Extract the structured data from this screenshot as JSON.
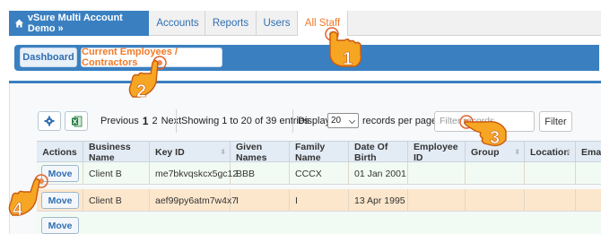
{
  "topnav": {
    "brand": "vSure Multi Account Demo »",
    "tabs": [
      {
        "label": "Accounts"
      },
      {
        "label": "Reports"
      },
      {
        "label": "Users"
      },
      {
        "label": "All Staff"
      }
    ]
  },
  "subnav": {
    "items": [
      {
        "label": "Dashboard"
      },
      {
        "label": "Current Employees / Contractors"
      }
    ]
  },
  "toolbar": {
    "previous": "Previous",
    "page1": "1",
    "page2": "2",
    "next": "Next",
    "showing": "Showing 1 to 20 of 39 entries",
    "display_label": "Display",
    "display_value": "20",
    "records_label": "records per page",
    "filter_placeholder": "Filter records",
    "filter_button": "Filter"
  },
  "table": {
    "columns": [
      "Actions",
      "Business Name",
      "Key ID",
      "Given Names",
      "Family Name",
      "Date Of Birth",
      "Employee ID",
      "Group",
      "Location",
      "Email"
    ],
    "rows": [
      {
        "action": "Move",
        "business": "Client B",
        "key": "me7bkvqskcx5gc12",
        "given": "BBB",
        "family": "CCCX",
        "dob": "01 Jan 2001"
      },
      {
        "action": "Move",
        "business": "Client B",
        "key": "aef99py6atm7w4x7",
        "given": "I",
        "family": "I",
        "dob": "13 Apr 1995"
      }
    ],
    "row3_action": "Move"
  },
  "callouts": [
    "1",
    "2",
    "3",
    "4"
  ],
  "colors": {
    "brand_blue": "#3a80c1",
    "accent_orange": "#f07a2a",
    "row_highlight": "#fde7cc"
  }
}
